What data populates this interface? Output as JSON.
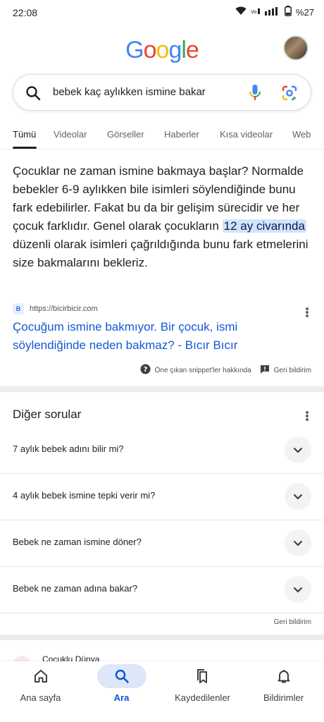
{
  "status_bar": {
    "time": "22:08",
    "battery": "%27"
  },
  "header": {
    "logo_letters": [
      "G",
      "o",
      "o",
      "g",
      "l",
      "e"
    ],
    "logo_colors": [
      "#4285F4",
      "#EA4335",
      "#FBBC05",
      "#4285F4",
      "#34A853",
      "#EA4335"
    ]
  },
  "search": {
    "query": "bebek kaç aylıkken ismine bakar"
  },
  "tabs": [
    "Tümü",
    "Videolar",
    "Görseller",
    "Haberler",
    "Kısa videolar",
    "Web"
  ],
  "snippet": {
    "text_before": "Çocuklar ne zaman ismine bakmaya başlar? Normalde bebekler 6-9 aylıkken bile isimleri söylendiğinde bunu fark edebilirler. Fakat bu da bir gelişim sürecidir ve her çocuk farklıdır. Genel olarak çocukların ",
    "highlight": "12 ay civarında",
    "text_after": " düzenli olarak isimleri çağrıldığında bunu fark etmelerini size bakmalarını bekleriz.",
    "source_url": "https://bicirbicir.com",
    "favicon_letter": "B",
    "result_title": "Çocuğum ismine bakmıyor. Bir çocuk, ismi söylendiğinde neden bakmaz? - Bıcır Bıcır",
    "about_snippets": "Öne çıkan snippet'ler hakkında",
    "feedback": "Geri bildirim"
  },
  "other_questions": {
    "title": "Diğer sorular",
    "items": [
      "7 aylık bebek adını bilir mi?",
      "4 aylık bebek ismine tepki verir mi?",
      "Bebek ne zaman ismine döner?",
      "Bebek ne zaman adına bakar?"
    ],
    "feedback": "Geri bildirim"
  },
  "next_result_peek": "Çocuklu Dünya",
  "bottom_nav": [
    {
      "label": "Ana sayfa",
      "icon": "home-icon"
    },
    {
      "label": "Ara",
      "icon": "search-icon"
    },
    {
      "label": "Kaydedilenler",
      "icon": "bookmarks-icon"
    },
    {
      "label": "Bildirimler",
      "icon": "bell-icon"
    }
  ]
}
